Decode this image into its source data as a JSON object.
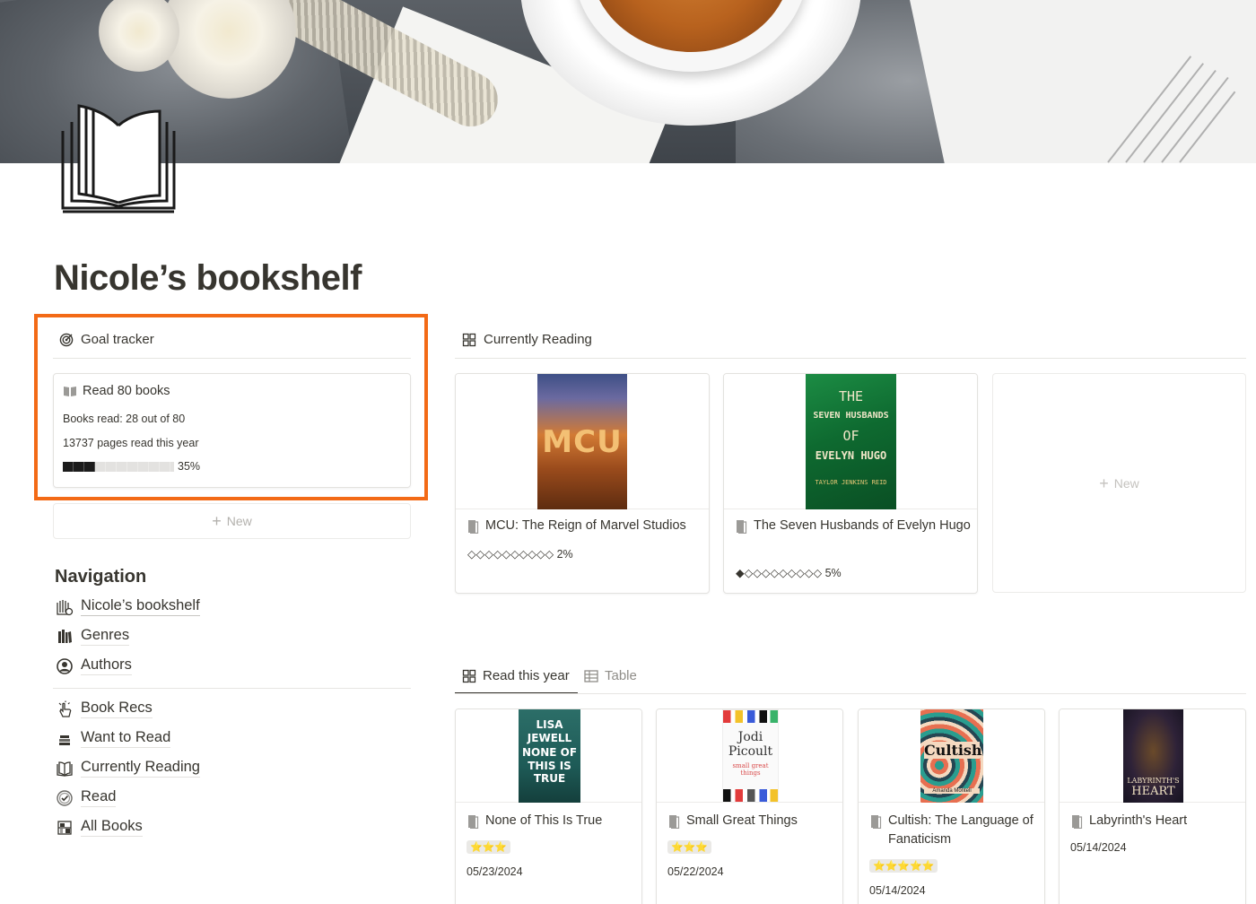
{
  "page": {
    "title": "Nicole’s bookshelf"
  },
  "goal_tracker": {
    "heading": "Goal tracker",
    "card": {
      "title": "Read 80 books",
      "books_read": "Books read: 28 out of 80",
      "pages_read": "13737 pages read this year",
      "progress": 0.35,
      "progress_label": "35%"
    },
    "new_label": "New"
  },
  "navigation": {
    "heading": "Navigation",
    "items": [
      {
        "label": "Nicole’s bookshelf",
        "icon": "books-icon"
      },
      {
        "label": "Genres",
        "icon": "library-icon"
      },
      {
        "label": "Authors",
        "icon": "user-circle-icon"
      },
      {
        "label": "Book Recs",
        "icon": "hand-pointing-icon"
      },
      {
        "label": "Want to Read",
        "icon": "stack-icon"
      },
      {
        "label": "Currently Reading",
        "icon": "open-book-icon"
      },
      {
        "label": "Read",
        "icon": "check-circle-icon"
      },
      {
        "label": "All Books",
        "icon": "shelf-grid-icon"
      }
    ]
  },
  "currently_reading": {
    "heading": "Currently Reading",
    "new_label": "New",
    "cards": [
      {
        "title": "MCU: The Reign of Marvel Studios",
        "progress_text": "◇◇◇◇◇◇◇◇◇◇ 2%",
        "progress": 0.02,
        "cover_text": "MCU",
        "cover_colors": [
          "#4c5a8a",
          "#c76a2a",
          "#e39a3a"
        ]
      },
      {
        "title": "The Seven Husbands of Evelyn Hugo",
        "progress_text": "◆◇◇◇◇◇◇◇◇◇ 5%",
        "progress": 0.05,
        "cover_lines": [
          "THE",
          "SEVEN HUSBANDS",
          "OF",
          "EVELYN HUGO",
          "TAYLOR JENKINS REID"
        ],
        "cover_colors": [
          "#157a3a",
          "#0f5e2c",
          "#d9c38a"
        ]
      }
    ]
  },
  "read_this_year": {
    "tabs": [
      {
        "label": "Read this year",
        "active": true,
        "icon": "gallery-icon"
      },
      {
        "label": "Table",
        "active": false,
        "icon": "table-icon"
      }
    ],
    "cards": [
      {
        "title": "None of This Is True",
        "rating": "⭐⭐⭐",
        "date": "05/23/2024",
        "cover_lines": [
          "LISA",
          "JEWELL",
          "NONE OF",
          "THIS IS",
          "TRUE"
        ],
        "cover_colors": [
          "#1e5b57",
          "#ffffff"
        ]
      },
      {
        "title": "Small Great Things",
        "rating": "⭐⭐⭐",
        "date": "05/22/2024",
        "cover_lines": [
          "Jodi",
          "Picoult",
          "small great",
          "things"
        ],
        "cover_colors": [
          "#ffffff",
          "#333333",
          "#d94b4b"
        ]
      },
      {
        "title": "Cultish: The Language of Fanaticism",
        "rating": "⭐⭐⭐⭐⭐",
        "date": "05/14/2024",
        "cover_lines": [
          "Cultish",
          "Amanda Montell"
        ],
        "cover_colors": [
          "#f4d9c0",
          "#2a9d8f",
          "#e76f51"
        ]
      },
      {
        "title": "Labyrinth's Heart",
        "date": "05/14/2024",
        "cover_lines": [
          "LABYRINTH'S",
          "HEART"
        ],
        "cover_colors": [
          "#1f1a2e",
          "#c9a24a"
        ]
      }
    ]
  },
  "colors": {
    "highlight": "#f36a16",
    "text": "#37352f",
    "muted": "#8f8d88"
  }
}
